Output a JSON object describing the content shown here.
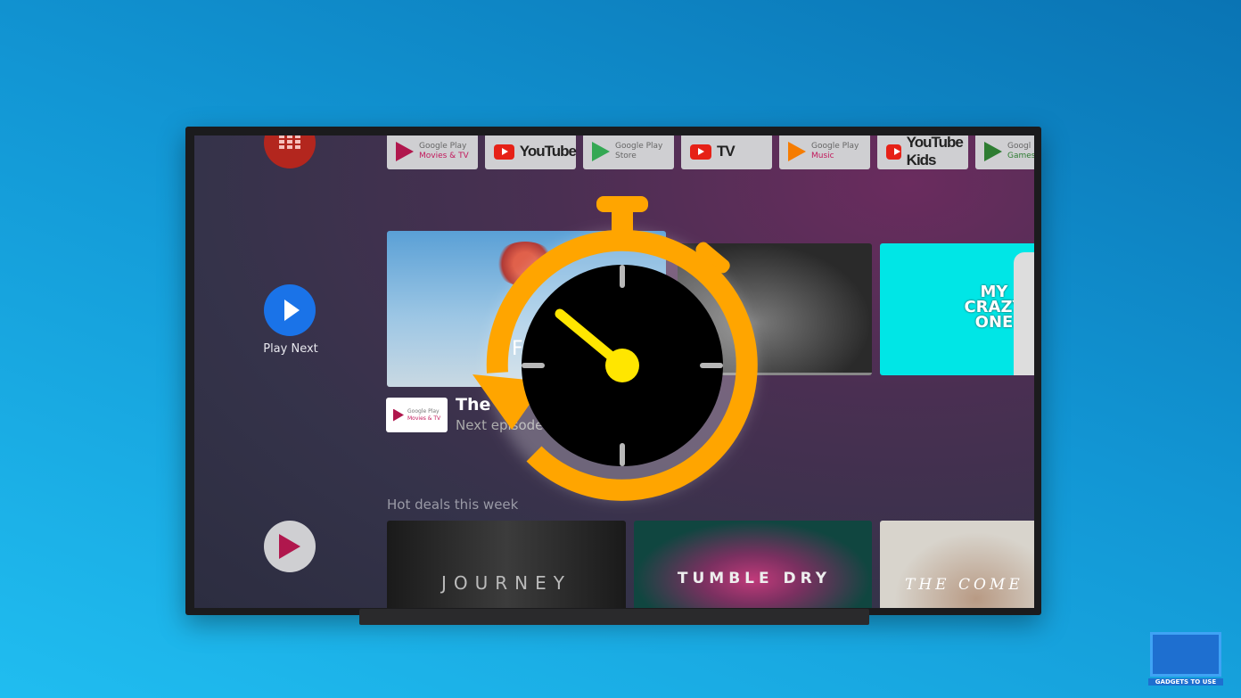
{
  "apps": [
    {
      "line1": "Google Play",
      "line2": "Movies & TV",
      "icon": "play-movies-icon"
    },
    {
      "big": "YouTube",
      "icon": "youtube-icon"
    },
    {
      "line1": "Google Play",
      "line2": "Store",
      "icon": "play-store-icon"
    },
    {
      "big": "TV",
      "icon": "youtube-tv-icon"
    },
    {
      "line1": "Google Play",
      "line2": "Music",
      "icon": "play-music-icon"
    },
    {
      "big": "YouTube Kids",
      "icon": "youtube-kids-icon"
    },
    {
      "line1": "Googl",
      "line2": "Games",
      "icon": "play-games-icon"
    }
  ],
  "rail": {
    "play_next": "Play Next"
  },
  "play_next": {
    "featured_title_fragment": "F",
    "card3_text": "MY CRAZY ONE",
    "channel_line1": "Google Play",
    "channel_line2": "Movies & TV",
    "title": "The",
    "subtitle": "Next episode"
  },
  "hot_deals": {
    "heading": "Hot deals this week",
    "cards": [
      "JOURNEY",
      "TUMBLE DRY",
      "THE COME"
    ]
  },
  "logo": {
    "text": "GADGETS TO USE"
  },
  "colors": {
    "stopwatch": "#ffa500",
    "hand": "#ffe600",
    "accent": "#1a73e8"
  }
}
